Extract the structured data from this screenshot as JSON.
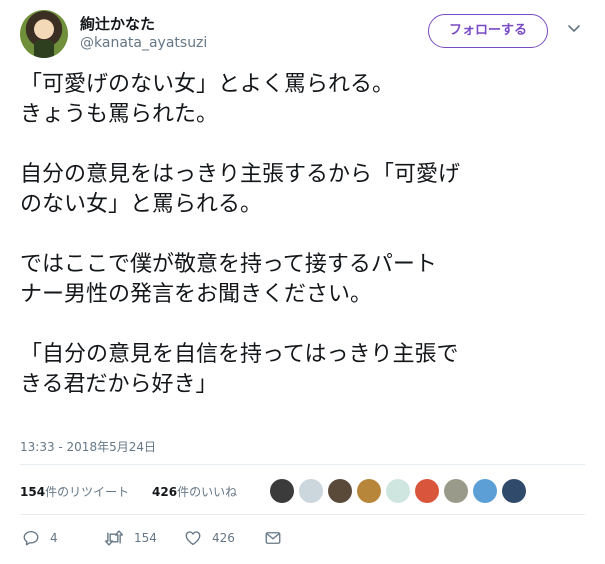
{
  "header": {
    "display_name": "絢辻かなた",
    "screen_name": "@kanata_ayatsuzi",
    "follow_label": "フォローする"
  },
  "tweet": {
    "paragraphs": [
      [
        "「可愛げのない女」とよく罵られる。",
        "きょうも罵られた。"
      ],
      [
        "自分の意見をはっきり主張するから「可愛げ",
        "のない女」と罵られる。"
      ],
      [
        "ではここで僕が敬意を持って接するパート",
        "ナー男性の発言をお聞きください。"
      ],
      [
        "「自分の意見を自信を持ってはっきり主張で",
        "きる君だから好き」"
      ]
    ],
    "timestamp": "13:33 - 2018年5月24日"
  },
  "stats": {
    "retweets_count": "154",
    "retweets_label": "件のリツイート",
    "likes_count": "426",
    "likes_label": "件のいいね"
  },
  "likers": [
    {
      "icon": "liker-avatar-1",
      "color": "#3b3b3b"
    },
    {
      "icon": "liker-avatar-2",
      "color": "#ccd6dd"
    },
    {
      "icon": "liker-avatar-3",
      "color": "#5a4a3a"
    },
    {
      "icon": "liker-avatar-4",
      "color": "#b8863b"
    },
    {
      "icon": "liker-avatar-5",
      "color": "#cfe6e0"
    },
    {
      "icon": "liker-avatar-6",
      "color": "#d9553b"
    },
    {
      "icon": "liker-avatar-7",
      "color": "#9a9a8a"
    },
    {
      "icon": "liker-avatar-8",
      "color": "#5b9fd6"
    },
    {
      "icon": "liker-avatar-9",
      "color": "#2f4a6b"
    }
  ],
  "actions": {
    "reply_count": "4",
    "retweet_count": "154",
    "like_count": "426"
  },
  "colors": {
    "accent": "#794bc4",
    "text": "#14171a",
    "secondary": "#657786",
    "border": "#e6ecf0"
  }
}
